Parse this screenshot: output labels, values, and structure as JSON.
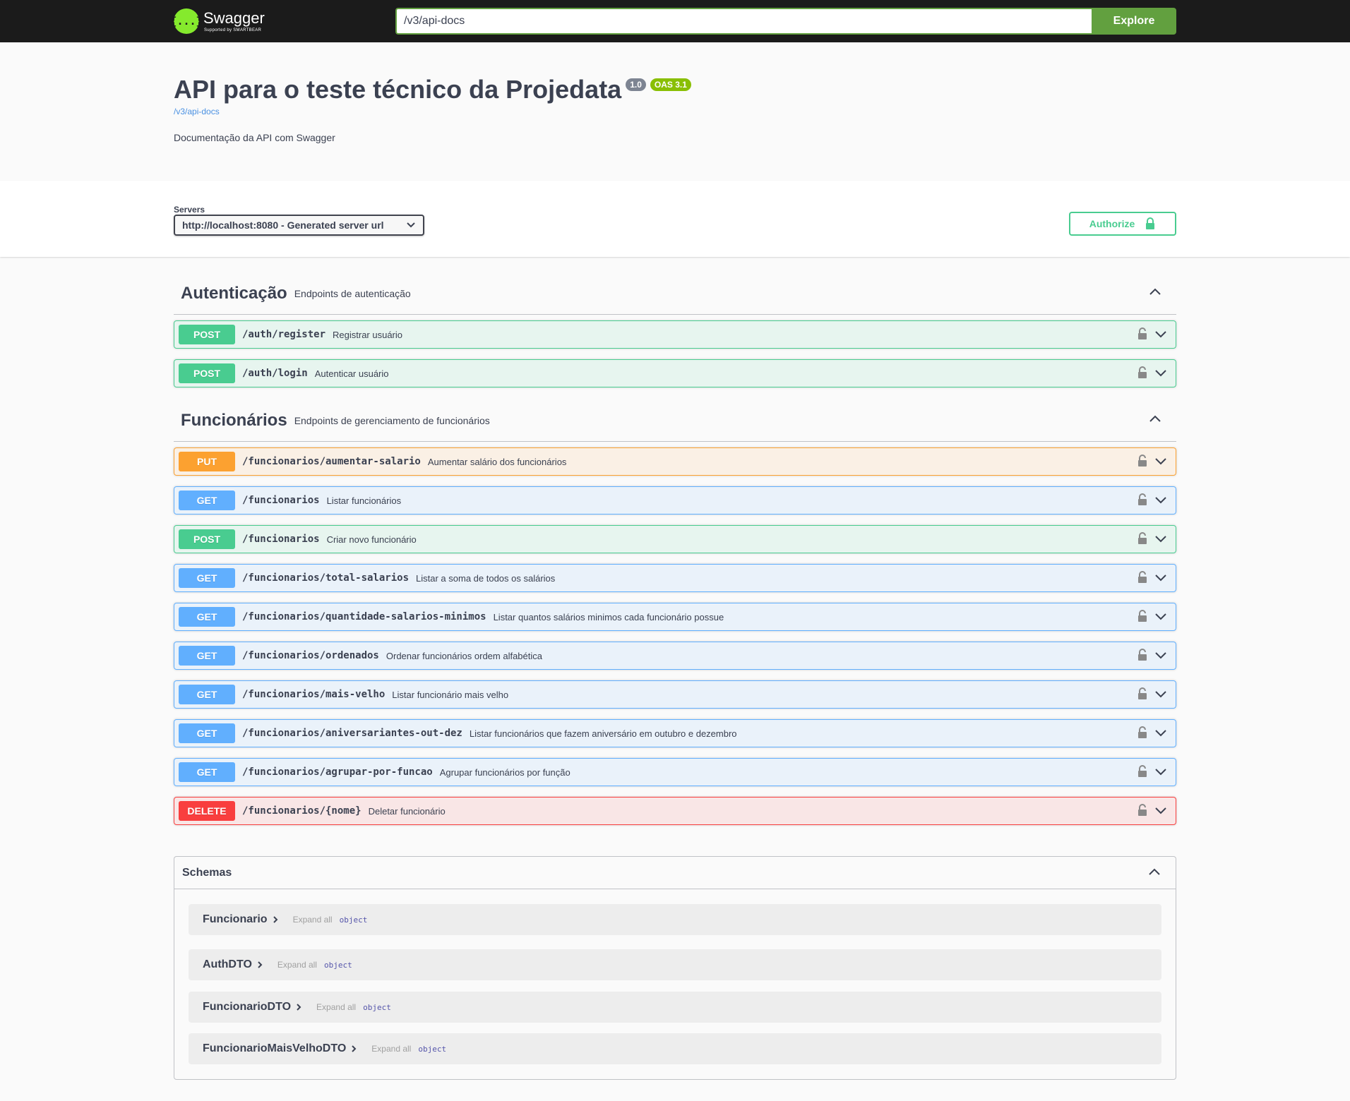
{
  "topbar": {
    "logo_name": "Swagger",
    "logo_sub": "Supported by SMARTBEAR",
    "logo_glyph": "{...}",
    "url_value": "/v3/api-docs",
    "explore_label": "Explore"
  },
  "info": {
    "title": "API para o teste técnico da Projedata",
    "version": "1.0",
    "oas": "OAS 3.1",
    "link": "/v3/api-docs",
    "description": "Documentação da API com Swagger"
  },
  "servers": {
    "label": "Servers",
    "selected": "http://localhost:8080 - Generated server url"
  },
  "authorize_label": "Authorize",
  "tags": [
    {
      "name": "Autenticação",
      "description": "Endpoints de autenticação",
      "operations": [
        {
          "method": "POST",
          "path": "/auth/register",
          "summary": "Registrar usuário"
        },
        {
          "method": "POST",
          "path": "/auth/login",
          "summary": "Autenticar usuário"
        }
      ]
    },
    {
      "name": "Funcionários",
      "description": "Endpoints de gerenciamento de funcionários",
      "operations": [
        {
          "method": "PUT",
          "path": "/funcionarios/aumentar-salario",
          "summary": "Aumentar salário dos funcionários"
        },
        {
          "method": "GET",
          "path": "/funcionarios",
          "summary": "Listar funcionários"
        },
        {
          "method": "POST",
          "path": "/funcionarios",
          "summary": "Criar novo funcionário"
        },
        {
          "method": "GET",
          "path": "/funcionarios/total-salarios",
          "summary": "Listar a soma de todos os salários"
        },
        {
          "method": "GET",
          "path": "/funcionarios/quantidade-salarios-minimos",
          "summary": "Listar quantos salários minimos cada funcionário possue"
        },
        {
          "method": "GET",
          "path": "/funcionarios/ordenados",
          "summary": "Ordenar funcionários ordem alfabética"
        },
        {
          "method": "GET",
          "path": "/funcionarios/mais-velho",
          "summary": "Listar funcionário mais velho"
        },
        {
          "method": "GET",
          "path": "/funcionarios/aniversariantes-out-dez",
          "summary": "Listar funcionários que fazem aniversário em outubro e dezembro"
        },
        {
          "method": "GET",
          "path": "/funcionarios/agrupar-por-funcao",
          "summary": "Agrupar funcionários por função"
        },
        {
          "method": "DELETE",
          "path": "/funcionarios/{nome}",
          "summary": "Deletar funcionário"
        }
      ]
    }
  ],
  "schemas": {
    "title": "Schemas",
    "expand_all": "Expand all",
    "models": [
      {
        "name": "Funcionario",
        "type": "object"
      },
      {
        "name": "AuthDTO",
        "type": "object"
      },
      {
        "name": "FuncionarioDTO",
        "type": "object"
      },
      {
        "name": "FuncionarioMaisVelhoDTO",
        "type": "object"
      }
    ]
  },
  "colors": {
    "post": "#49cc90",
    "get": "#61affe",
    "put": "#fca130",
    "delete": "#f93e3e",
    "topbar": "#1b1b1b",
    "explore": "#62a03f"
  },
  "icons": [
    "swagger-logo-icon",
    "chevron-down-icon",
    "chevron-up-icon",
    "lock-icon",
    "chevron-right-icon"
  ]
}
